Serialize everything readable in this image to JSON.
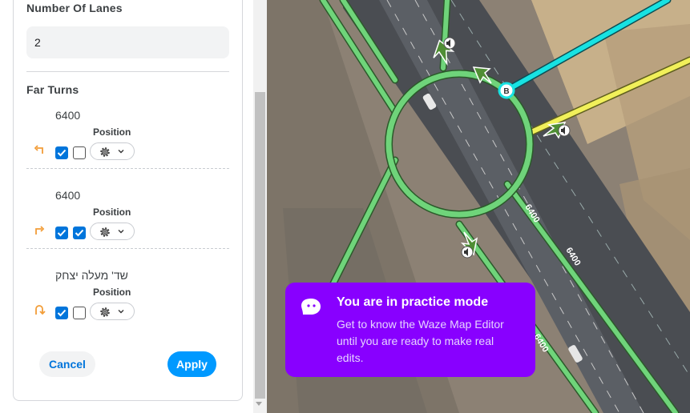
{
  "panel": {
    "lanes_title": "Number Of Lanes",
    "lanes_value": "2",
    "far_turns_title": "Far Turns",
    "position_label": "Position",
    "turns": [
      {
        "name": "6400",
        "direction": "left",
        "check1": true,
        "check2": false
      },
      {
        "name": "6400",
        "direction": "right",
        "check1": true,
        "check2": true
      },
      {
        "name": "שד' מעלה יצחק",
        "direction": "u-turn",
        "check1": true,
        "check2": false
      }
    ],
    "cancel_label": "Cancel",
    "apply_label": "Apply"
  },
  "map": {
    "node_label": "B",
    "road_labels": [
      "6400",
      "6400",
      "6400"
    ],
    "colors": {
      "road_green": "#6fd47a",
      "selected_cyan": "#18e2e2",
      "selected_yellow": "#f1f05a",
      "arrow_green": "#4f8e34"
    }
  },
  "toast": {
    "title": "You are in practice mode",
    "body": "Get to know the Waze Map Editor until you are ready to make real edits.",
    "bg": "#8800ff"
  }
}
